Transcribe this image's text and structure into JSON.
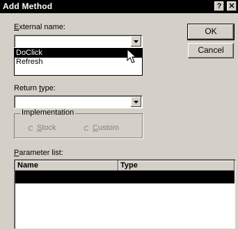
{
  "window": {
    "title": "Add Method",
    "help_button": "?",
    "close_button": "✕"
  },
  "external_name": {
    "label_pre": "",
    "label_mnemonic": "E",
    "label_post": "xternal name:",
    "value": "",
    "options": [
      "DoClick",
      "Refresh"
    ],
    "selected_index": 0
  },
  "buttons": {
    "ok": "OK",
    "cancel": "Cancel"
  },
  "return_type": {
    "label_pre": "Return ",
    "label_mnemonic": "t",
    "label_post": "ype:",
    "value": ""
  },
  "implementation": {
    "title": "Implementation",
    "stock_pre": "",
    "stock_mnemonic": "S",
    "stock_post": "tock",
    "custom_pre": "",
    "custom_mnemonic": "C",
    "custom_post": "ustom"
  },
  "parameter_list": {
    "label_pre": "",
    "label_mnemonic": "P",
    "label_post": "arameter list:",
    "columns": [
      "Name",
      "Type"
    ]
  }
}
